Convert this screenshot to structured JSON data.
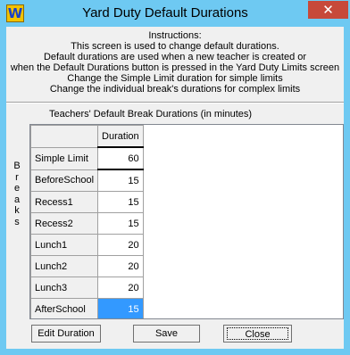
{
  "window": {
    "title": "Yard Duty Default Durations",
    "app_icon": "W",
    "close_glyph": "✕"
  },
  "instructions": {
    "heading": "Instructions:",
    "lines": [
      "This screen is used to change default durations.",
      "Default durations are used when a new teacher is created or",
      "when the Default Durations button is pressed in the Yard Duty Limits screen",
      "Change the Simple Limit duration for simple limits",
      "Change the individual break's durations for complex limits"
    ]
  },
  "grid": {
    "title": "Teachers' Default Break Durations (in minutes)",
    "side_label": [
      "B",
      "r",
      "e",
      "a",
      "k",
      "s"
    ],
    "column_header": "Duration",
    "rows": [
      {
        "label": "Simple Limit",
        "value": "60"
      },
      {
        "label": "BeforeSchool",
        "value": "15"
      },
      {
        "label": "Recess1",
        "value": "15"
      },
      {
        "label": "Recess2",
        "value": "15"
      },
      {
        "label": "Lunch1",
        "value": "20"
      },
      {
        "label": "Lunch2",
        "value": "20"
      },
      {
        "label": "Lunch3",
        "value": "20"
      },
      {
        "label": "AfterSchool",
        "value": "15"
      }
    ],
    "selected_row": "AfterSchool"
  },
  "buttons": {
    "edit_duration": "Edit Duration",
    "save": "Save",
    "close": "Close"
  },
  "colors": {
    "titlebar": "#6ec9f2",
    "close_button": "#c7493a",
    "selection": "#3399ff"
  }
}
